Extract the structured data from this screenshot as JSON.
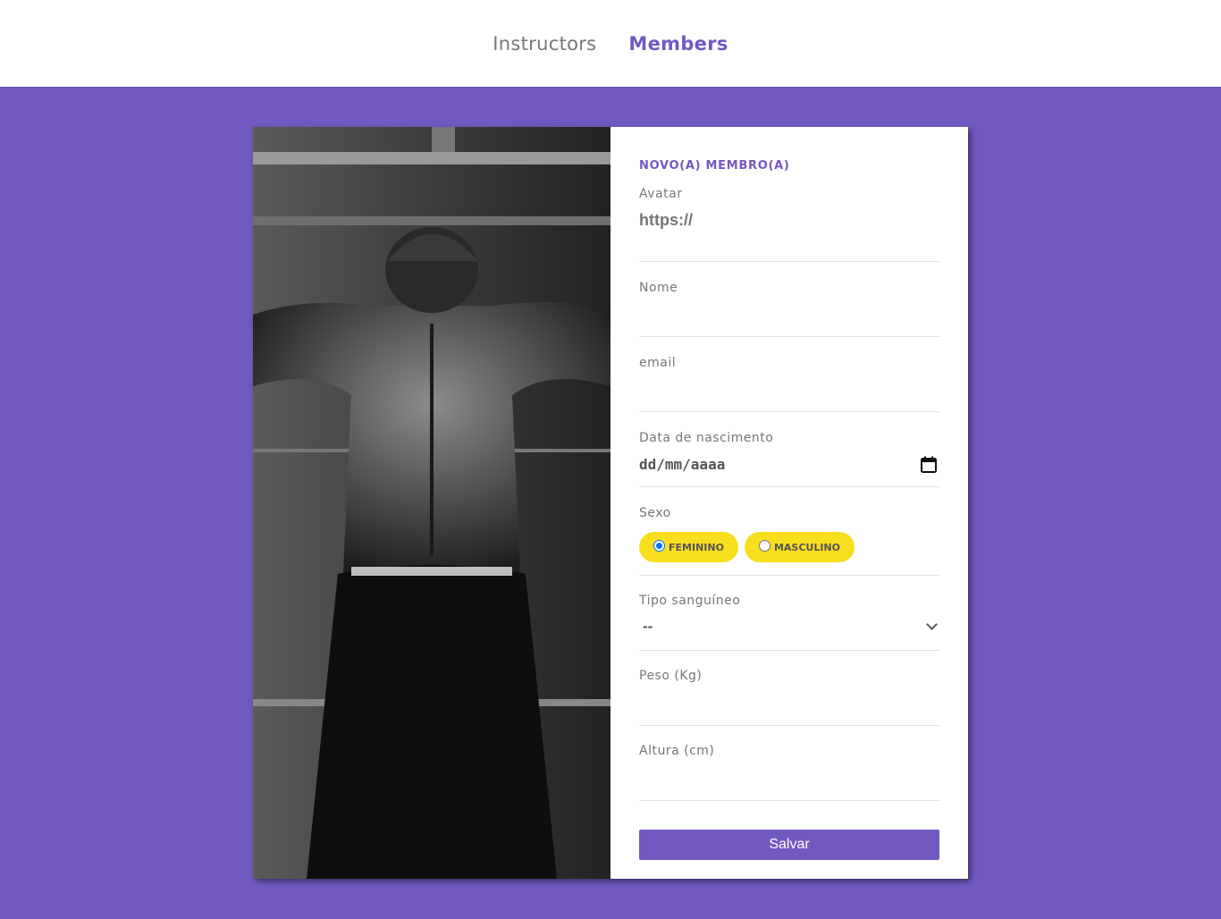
{
  "nav": {
    "links": [
      {
        "label": "Instructors",
        "active": false
      },
      {
        "label": "Members",
        "active": true
      }
    ]
  },
  "colors": {
    "accent": "#7159c1",
    "pill": "#f7df1e",
    "text": "#777777"
  },
  "photo": {
    "description_icon": "gym-athlete-back-photo"
  },
  "form": {
    "title": "NOVO(A) MEMBRO(A)",
    "avatar": {
      "label": "Avatar",
      "placeholder": "https://"
    },
    "nome": {
      "label": "Nome",
      "placeholder": ""
    },
    "email": {
      "label": "email",
      "placeholder": ""
    },
    "birth": {
      "label": "Data de nascimento",
      "placeholder": "dd/mm/aaaa"
    },
    "sexo": {
      "label": "Sexo",
      "options": [
        {
          "label": "FEMININO",
          "checked": true
        },
        {
          "label": "MASCULINO",
          "checked": false
        }
      ]
    },
    "blood": {
      "label": "Tipo sanguíneo",
      "selected": "--"
    },
    "peso": {
      "label": "Peso (Kg)",
      "placeholder": ""
    },
    "altura": {
      "label": "Altura (cm)",
      "placeholder": ""
    },
    "save_label": "Salvar"
  }
}
